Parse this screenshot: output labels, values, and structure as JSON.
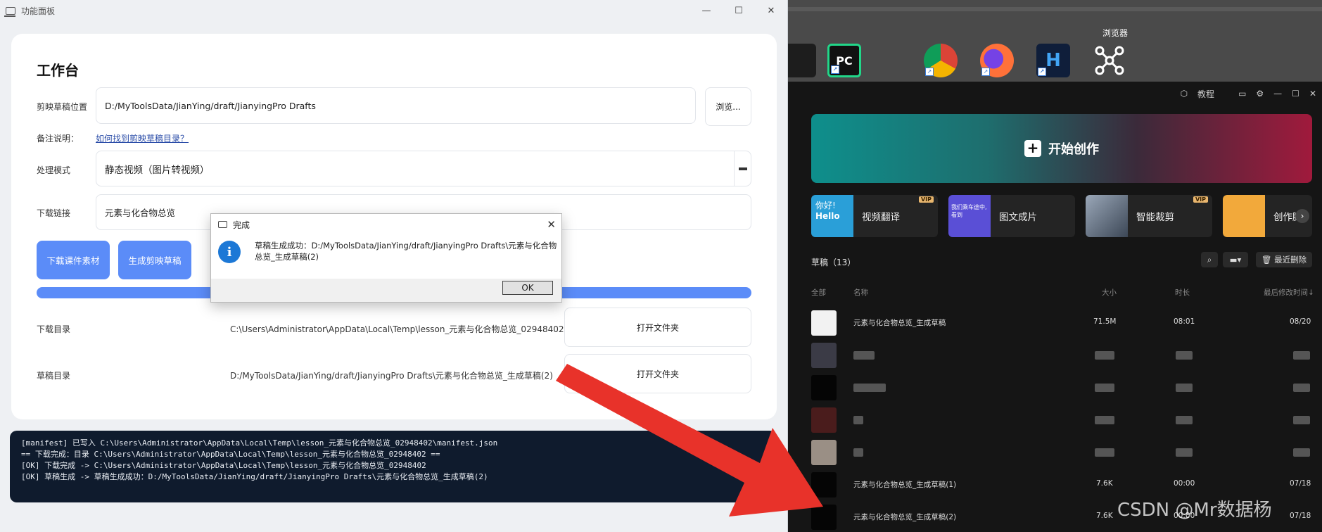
{
  "tool_window": {
    "title": "功能面板",
    "controls": {
      "minimize": "—",
      "maximize": "☐",
      "close": "✕"
    },
    "heading": "工作台",
    "draft_location": {
      "label": "剪映草稿位置",
      "value": "D:/MyToolsData/JianYing/draft/JianyingPro Drafts",
      "browse_label": "浏览..."
    },
    "note": {
      "label": "备注说明：",
      "link": "如何找到剪映草稿目录？"
    },
    "mode": {
      "label": "处理模式",
      "value": "静态视频（图片转视频）"
    },
    "download_link": {
      "label": "下载链接",
      "value": "元素与化合物总览"
    },
    "buttons": {
      "download": "下载课件素材",
      "generate": "生成剪映草稿"
    },
    "progress": 1.0,
    "download_dir": {
      "label": "下载目录",
      "path": "C:\\Users\\Administrator\\AppData\\Local\\Temp\\lesson_元素与化合物总览_02948402",
      "open": "打开文件夹"
    },
    "draft_dir": {
      "label": "草稿目录",
      "path": "D:/MyToolsData/JianYing/draft/JianyingPro Drafts\\元素与化合物总览_生成草稿(2)",
      "open": "打开文件夹"
    },
    "log": [
      "[manifest] 已写入 C:\\Users\\Administrator\\AppData\\Local\\Temp\\lesson_元素与化合物总览_02948402\\manifest.json",
      "== 下载完成：目录 C:\\Users\\Administrator\\AppData\\Local\\Temp\\lesson_元素与化合物总览_02948402 ==",
      "[OK] 下载完成 -> C:\\Users\\Administrator\\AppData\\Local\\Temp\\lesson_元素与化合物总览_02948402",
      "[OK] 草稿生成 -> 草稿生成成功：D:/MyToolsData/JianYing/draft/JianyingPro Drafts\\元素与化合物总览_生成草稿(2)"
    ]
  },
  "dialog": {
    "title": "完成",
    "close": "✕",
    "icon": "i",
    "message": "草稿生成成功：D:/MyToolsData/JianYing/draft/JianyingPro Drafts\\元素与化合物总览_生成草稿(2)",
    "ok": "OK"
  },
  "desktop": {
    "browser_label": "浏览器",
    "pc_icon": "PC"
  },
  "jianying": {
    "top": {
      "tutorial": "教程",
      "min": "—",
      "max": "☐",
      "close": "✕"
    },
    "create": "开始创作",
    "tiles": [
      {
        "label": "视频翻译",
        "vip": "VIP",
        "thumb_text": "Hello",
        "thumb_text2": "你好!"
      },
      {
        "label": "图文成片",
        "vip": "",
        "thumb_text": "我们乘车途中, 看到"
      },
      {
        "label": "智能裁剪",
        "vip": "VIP"
      },
      {
        "label": "创作脚",
        "vip": ""
      }
    ],
    "drafts_title": "草稿（13）",
    "recent_delete": "最近删除",
    "columns": {
      "all": "全部",
      "name": "名称",
      "size": "大小",
      "duration": "时长",
      "modified": "最后修改时间↓"
    },
    "rows": [
      {
        "name": "元素与化合物总览_生成草稿",
        "size": "71.5M",
        "duration": "08:01",
        "modified": "08/20"
      },
      {
        "name": "",
        "size": "",
        "duration": "",
        "modified": ""
      },
      {
        "name": "",
        "size": "",
        "duration": "",
        "modified": ""
      },
      {
        "name": "",
        "size": "",
        "duration": "",
        "modified": ""
      },
      {
        "name": "",
        "size": "",
        "duration": "",
        "modified": ""
      },
      {
        "name": "元素与化合物总览_生成草稿(1)",
        "size": "7.6K",
        "duration": "00:00",
        "modified": "07/18"
      },
      {
        "name": "元素与化合物总览_生成草稿(2)",
        "size": "7.6K",
        "duration": "00:00",
        "modified": "07/18"
      }
    ]
  },
  "watermark": "CSDN @Mr数据杨",
  "colors": {
    "accent": "#5b8cf8",
    "log_bg": "#0f1b2d",
    "arrow": "#e8322a"
  }
}
